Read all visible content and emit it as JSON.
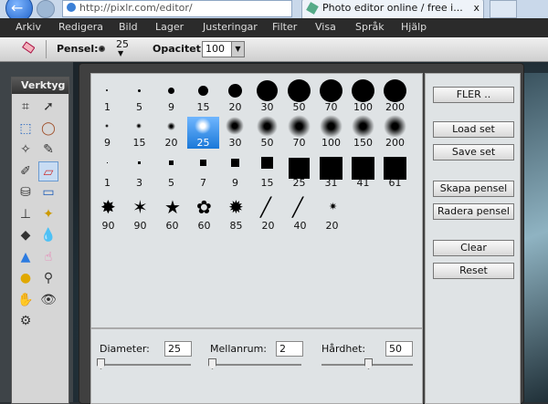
{
  "browser": {
    "url": "http://pixlr.com/editor/",
    "tab_title": "Photo editor online / free i...",
    "tab_close": "x"
  },
  "menu": [
    "Arkiv",
    "Redigera",
    "Bild",
    "Lager",
    "Justeringar",
    "Filter",
    "Visa",
    "Språk",
    "Hjälp"
  ],
  "options_bar": {
    "brush_label": "Pensel:",
    "brush_size": "25",
    "opacity_label": "Opacitet:",
    "opacity_value": "100"
  },
  "toolbox": {
    "title": "Verktyg",
    "tools": [
      "crop-icon",
      "move-icon",
      "marquee-icon",
      "lasso-icon",
      "magic-wand-icon",
      "pencil-icon",
      "brush-icon",
      "eraser-icon",
      "bucket-icon",
      "gradient-icon",
      "clone-stamp-icon",
      "color-replace-icon",
      "shape-icon",
      "blur-icon",
      "sharpen-icon",
      "smudge-icon",
      "sponge-icon",
      "dodge-icon",
      "burn-icon",
      "red-eye-icon",
      "spot-heal-icon"
    ]
  },
  "brush_panel": {
    "rows": [
      {
        "shape": "soft-round-hard",
        "labels": [
          "1",
          "5",
          "9",
          "15",
          "20",
          "30",
          "50",
          "70",
          "100",
          "200"
        ]
      },
      {
        "shape": "soft-round-blur",
        "labels": [
          "9",
          "15",
          "20",
          "25",
          "30",
          "50",
          "70",
          "100",
          "150",
          "200"
        ]
      },
      {
        "shape": "square",
        "labels": [
          "1",
          "3",
          "5",
          "7",
          "9",
          "15",
          "25",
          "31",
          "41",
          "61"
        ]
      },
      {
        "shape": "special",
        "labels": [
          "90",
          "90",
          "60",
          "60",
          "85",
          "20",
          "40",
          "20"
        ]
      }
    ],
    "selected": {
      "row": 1,
      "index": 3
    },
    "buttons": {
      "more": "FLER ..",
      "load": "Load set",
      "save": "Save set",
      "create": "Skapa pensel",
      "delete": "Radera pensel",
      "clear": "Clear",
      "reset": "Reset"
    },
    "sliders": {
      "diameter_label": "Diameter:",
      "diameter_value": "25",
      "spacing_label": "Mellanrum:",
      "spacing_value": "2",
      "hardness_label": "Hårdhet:",
      "hardness_value": "50"
    }
  }
}
